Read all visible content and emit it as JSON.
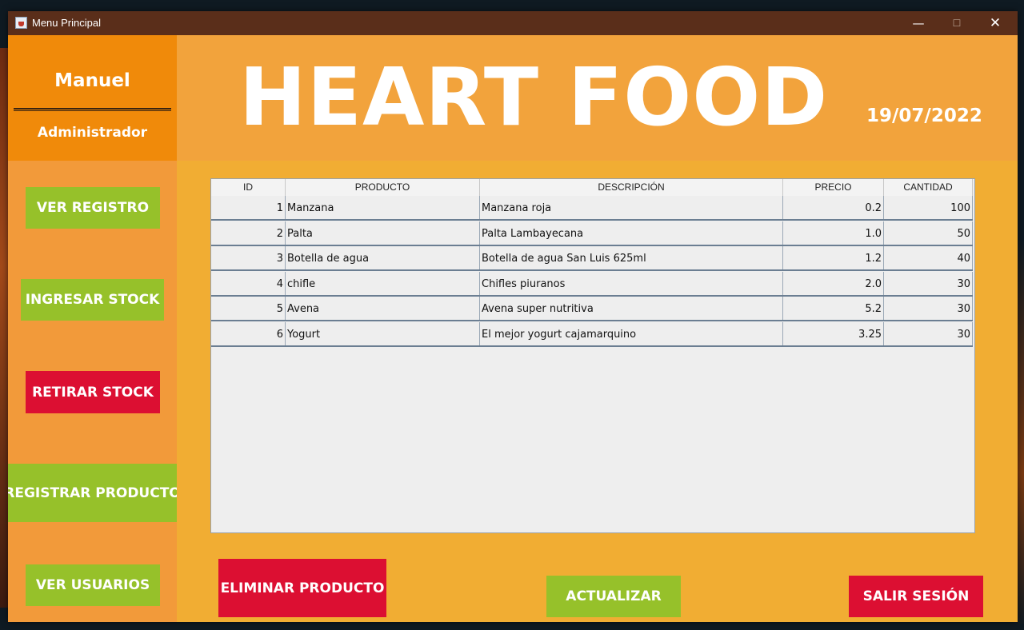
{
  "window": {
    "title": "Menu Principal",
    "controls": {
      "minimize": "—",
      "maximize": "☐",
      "close": "✕"
    }
  },
  "user": {
    "name": "Manuel",
    "role": "Administrador"
  },
  "header": {
    "brand": "HEART FOOD",
    "date": "19/07/2022"
  },
  "sidebar": {
    "ver_registro": "VER REGISTRO",
    "ingresar_stock": "INGRESAR STOCK",
    "retirar_stock": "RETIRAR STOCK",
    "registrar_producto": "REGISTRAR PRODUCTO",
    "ver_usuarios": "VER USUARIOS"
  },
  "table": {
    "columns": [
      "ID",
      "PRODUCTO",
      "DESCRIPCIÓN",
      "PRECIO",
      "CANTIDAD"
    ],
    "rows": [
      [
        "1",
        "Manzana",
        "Manzana roja",
        "0.2",
        "100"
      ],
      [
        "2",
        "Palta",
        "Palta Lambayecana",
        "1.0",
        "50"
      ],
      [
        "3",
        "Botella de agua",
        "Botella de agua San Luis 625ml",
        "1.2",
        "40"
      ],
      [
        "4",
        "chifle",
        "Chifles piuranos",
        "2.0",
        "30"
      ],
      [
        "5",
        "Avena",
        "Avena super nutritiva",
        "5.2",
        "30"
      ],
      [
        "6",
        "Yogurt",
        "El mejor yogurt cajamarquino",
        "3.25",
        "30"
      ]
    ]
  },
  "actions": {
    "eliminar": "ELIMINAR PRODUCTO",
    "actualizar": "ACTUALIZAR",
    "salir": "SALIR SESIÓN"
  },
  "colors": {
    "accent_green": "#96c12a",
    "accent_red": "#dc0f32",
    "header_orange": "#f2a33c",
    "user_panel_orange": "#f08a0a",
    "titlebar": "#5a2e1a"
  }
}
